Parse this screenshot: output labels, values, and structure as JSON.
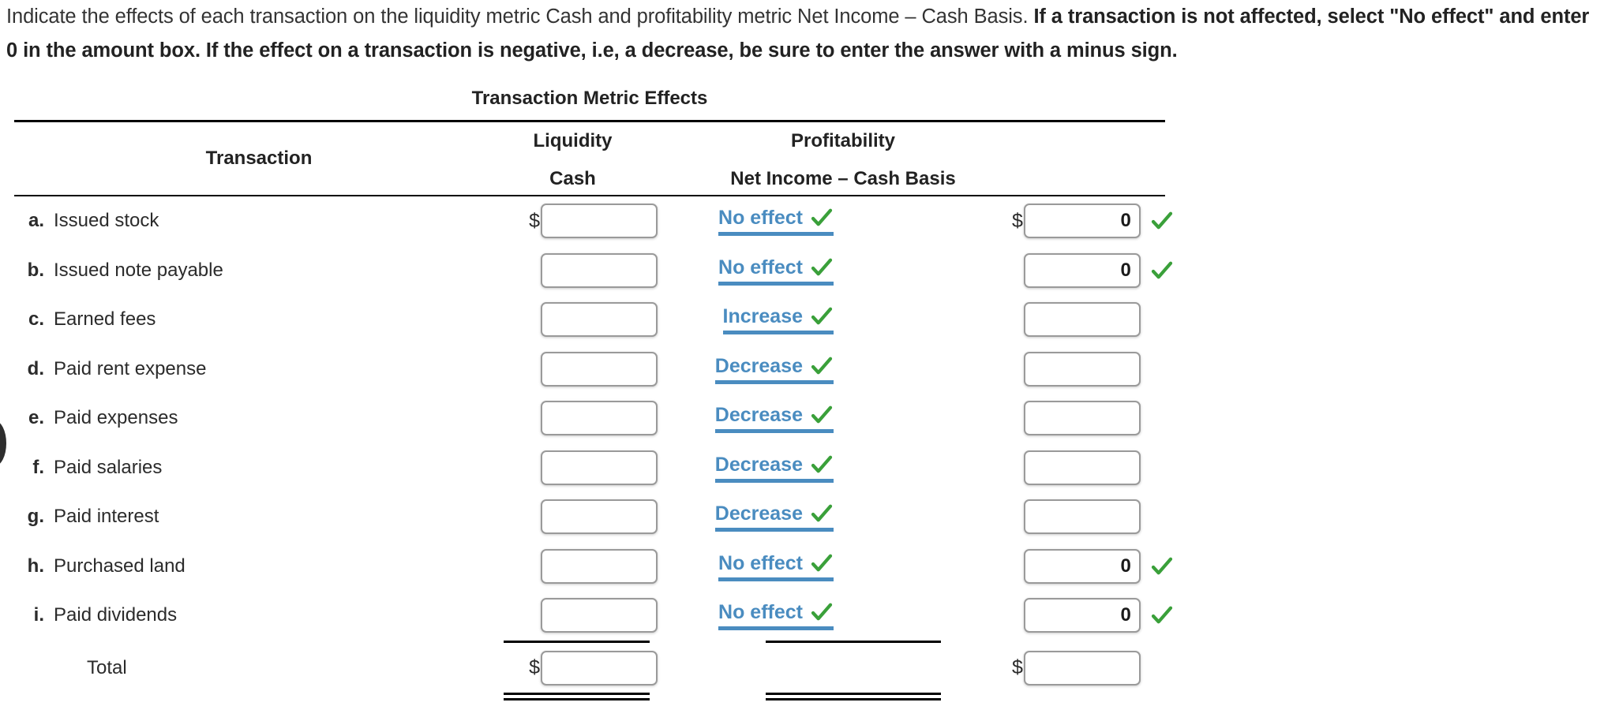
{
  "instructions": {
    "part1": "Indicate the effects of each transaction on the liquidity metric Cash and profitability metric Net Income – Cash Basis. ",
    "part2": "If a transaction is not affected, select \"No effect\" and enter 0 in the amount box. If the effect on a transaction is negative, i.e, a decrease, be sure to enter the answer with a minus sign."
  },
  "table": {
    "title": "Transaction Metric Effects",
    "headers": {
      "transaction": "Transaction",
      "liquidity": "Liquidity",
      "cash": "Cash",
      "profitability": "Profitability",
      "net_income": "Net Income – Cash Basis"
    },
    "dollar_sign": "$",
    "total_label": "Total",
    "colors": {
      "select_blue": "#4a8cc0",
      "check_green": "#3aa03a",
      "rule_black": "#000000",
      "box_border": "#9a9a9a"
    },
    "rows": [
      {
        "letter": "a.",
        "label": "Issued stock",
        "cash_dollar": true,
        "cash_value": "",
        "effect": "No effect",
        "effect_check": true,
        "ni_dollar": true,
        "ni_value": "0",
        "ni_check": true
      },
      {
        "letter": "b.",
        "label": "Issued note payable",
        "cash_dollar": false,
        "cash_value": "",
        "effect": "No effect",
        "effect_check": true,
        "ni_dollar": false,
        "ni_value": "0",
        "ni_check": true
      },
      {
        "letter": "c.",
        "label": "Earned fees",
        "cash_dollar": false,
        "cash_value": "",
        "effect": "Increase",
        "effect_check": true,
        "ni_dollar": false,
        "ni_value": "",
        "ni_check": false
      },
      {
        "letter": "d.",
        "label": "Paid rent expense",
        "cash_dollar": false,
        "cash_value": "",
        "effect": "Decrease",
        "effect_check": true,
        "ni_dollar": false,
        "ni_value": "",
        "ni_check": false
      },
      {
        "letter": "e.",
        "label": "Paid expenses",
        "cash_dollar": false,
        "cash_value": "",
        "effect": "Decrease",
        "effect_check": true,
        "ni_dollar": false,
        "ni_value": "",
        "ni_check": false
      },
      {
        "letter": "f.",
        "label": "Paid salaries",
        "cash_dollar": false,
        "cash_value": "",
        "effect": "Decrease",
        "effect_check": true,
        "ni_dollar": false,
        "ni_value": "",
        "ni_check": false
      },
      {
        "letter": "g.",
        "label": "Paid interest",
        "cash_dollar": false,
        "cash_value": "",
        "effect": "Decrease",
        "effect_check": true,
        "ni_dollar": false,
        "ni_value": "",
        "ni_check": false
      },
      {
        "letter": "h.",
        "label": "Purchased land",
        "cash_dollar": false,
        "cash_value": "",
        "effect": "No effect",
        "effect_check": true,
        "ni_dollar": false,
        "ni_value": "0",
        "ni_check": true
      },
      {
        "letter": "i.",
        "label": "Paid dividends",
        "cash_dollar": false,
        "cash_value": "",
        "effect": "No effect",
        "effect_check": true,
        "ni_dollar": false,
        "ni_value": "0",
        "ni_check": true
      }
    ],
    "total_row": {
      "letter": "",
      "label": "Total",
      "cash_dollar": true,
      "cash_value": "",
      "ni_dollar": true,
      "ni_value": ""
    }
  }
}
